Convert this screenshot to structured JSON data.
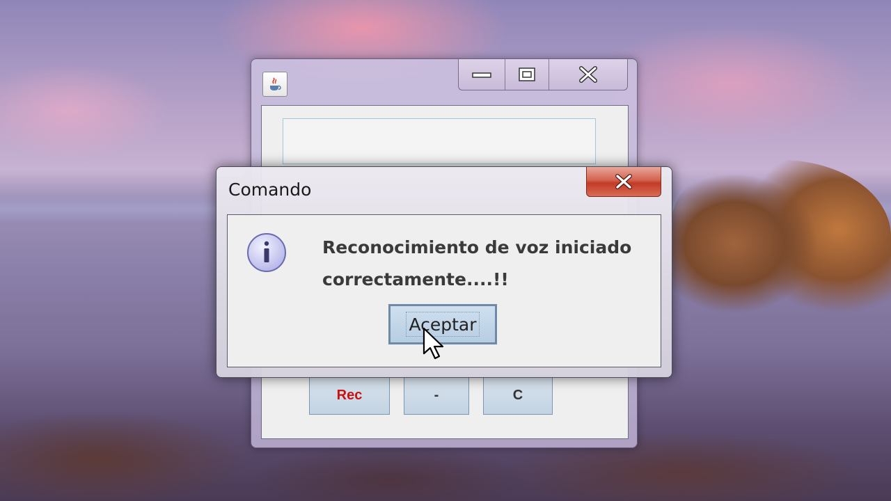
{
  "main_window": {
    "icon": "java-icon",
    "caption_buttons": [
      "minimize-icon",
      "maximize-icon",
      "close-icon"
    ],
    "buttons": {
      "rec_label": "Rec",
      "minus_label": "-",
      "clear_label": "C"
    },
    "colors": {
      "rec_text": "#cc1111"
    }
  },
  "dialog": {
    "title": "Comando",
    "icon": "info-icon",
    "message_line1": "Reconocimiento de voz iniciado",
    "message_line2": "correctamente....!!",
    "accept_label": "Aceptar",
    "close_icon": "close-icon",
    "colors": {
      "close_button": "#c23b26",
      "accept_border": "#6e8aa6"
    }
  }
}
